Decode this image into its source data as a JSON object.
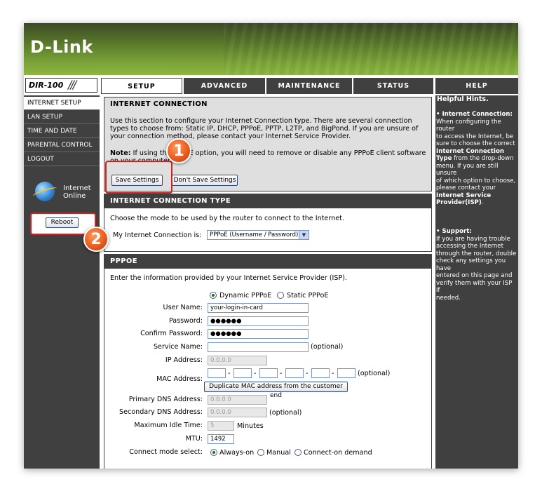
{
  "brand": {
    "logo": "D-Link",
    "model": "DIR-100",
    "slashes": "///"
  },
  "tabs": [
    "SETUP",
    "ADVANCED",
    "MAINTENANCE",
    "STATUS",
    "HELP"
  ],
  "nav": [
    "INTERNET SETUP",
    "LAN SETUP",
    "TIME AND DATE",
    "PARENTAL CONTROL",
    "LOGOUT"
  ],
  "status": {
    "line1": "Internet",
    "line2": "Online"
  },
  "reboot_label": "Reboot",
  "markers": [
    "1",
    "2"
  ],
  "internet_connection": {
    "title": "INTERNET CONNECTION",
    "desc1": "Use this section to configure your Internet Connection type. There are several connection",
    "desc2": "types to choose from: Static IP, DHCP, PPPoE, PPTP, L2TP, and BigPond. If you are unsure of",
    "desc3": "your connection method, please contact your Internet Service Provider.",
    "note_label": "Note:",
    "note_text": "If using the PPPoE option, you will need to remove or disable any PPPoE client software",
    "note_text2": "on your computers.",
    "save_label": "Save Settings",
    "dont_save_label": "Don't Save Settings"
  },
  "connection_type": {
    "title": "INTERNET CONNECTION TYPE",
    "desc": "Choose the mode to be used by the router to connect to the Internet.",
    "label": "My Internet Connection is:",
    "value": "PPPoE (Username / Password)"
  },
  "pppoe": {
    "title": "PPPOE",
    "desc": "Enter the information provided by your Internet Service Provider (ISP).",
    "dynamic_label": "Dynamic PPPoE",
    "static_label": "Static PPPoE",
    "user_name_label": "User Name:",
    "user_name_value": "your-login-in-card",
    "password_label": "Password:",
    "password_value": "●●●●●●",
    "confirm_label": "Confirm Password:",
    "confirm_value": "●●●●●●",
    "service_label": "Service Name:",
    "optional": "(optional)",
    "ip_label": "IP Address:",
    "ip_value": "0.0.0.0",
    "mac_label": "MAC Address:",
    "mac_dash": "-",
    "clone_label": "Duplicate MAC address from the customer end",
    "pdns_label": "Primary DNS Address:",
    "pdns_value": "0.0.0.0",
    "sdns_label": "Secondary DNS Address:",
    "sdns_value": "0.0.0.0",
    "idle_label": "Maximum Idle Time:",
    "idle_value": "5",
    "minutes": "Minutes",
    "mtu_label": "MTU:",
    "mtu_value": "1492",
    "mode_label": "Connect mode select:",
    "always_on": "Always-on",
    "manual": "Manual",
    "on_demand": "Connect-on demand"
  },
  "help": {
    "title": "Helpful Hints.",
    "ic_title": "• Internet Connection:",
    "ic_l1": "When configuring the router",
    "ic_l2": "to access the Internet, be",
    "ic_l3": "sure to choose the correct",
    "ic_b1": "Internet Connection",
    "ic_b2": "Type",
    "ic_l4": " from the drop-down",
    "ic_l5": "menu. If you are still unsure",
    "ic_l6": "of which option to choose,",
    "ic_l7": "please contact your",
    "ic_b3": "Internet Service",
    "ic_b4": "Provider(ISP)",
    "ic_end": ".",
    "sup_title": "• Support:",
    "sup_l1": "If you are having trouble",
    "sup_l2": "accessing the Internet",
    "sup_l3": "through the router, double",
    "sup_l4": "check any settings you have",
    "sup_l5": "entered on this page and",
    "sup_l6": "verify them with your ISP if",
    "sup_l7": "needed."
  }
}
